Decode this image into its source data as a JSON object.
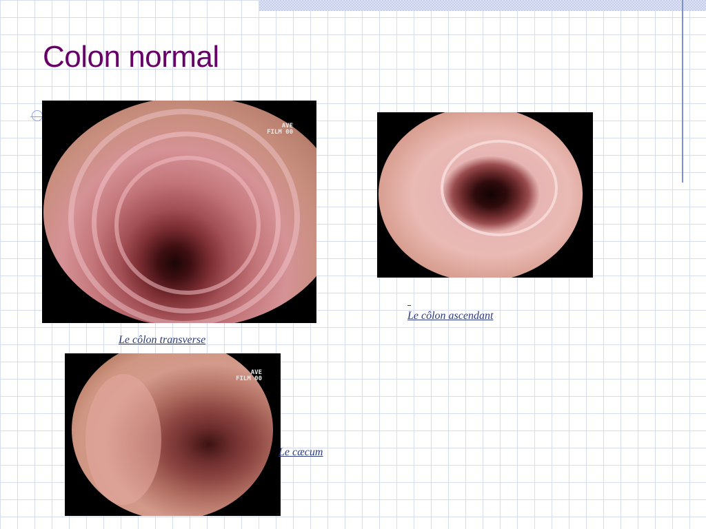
{
  "slide": {
    "title": "Colon normal"
  },
  "images": [
    {
      "caption": "Le côlon transverse",
      "overlay_line1": "AVE",
      "overlay_line2": "FILM 00"
    },
    {
      "caption": "Le côlon ascendant"
    },
    {
      "caption": "Le cæcum",
      "overlay_line1": "AVE",
      "overlay_line2": "FILM 00"
    }
  ],
  "colors": {
    "title": "#660066",
    "caption_link": "#2a3a7c",
    "grid": "#d6dcf0",
    "accent_rule": "#7e8fcf"
  }
}
